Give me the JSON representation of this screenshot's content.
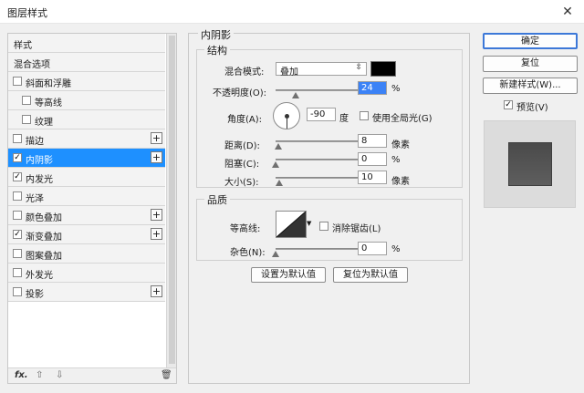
{
  "window": {
    "title": "图层样式",
    "close_glyph": "✕"
  },
  "left": {
    "items": [
      {
        "label": "样式",
        "has_check": false,
        "checked": false,
        "indent": 0,
        "has_plus": false,
        "selected": false
      },
      {
        "label": "混合选项",
        "has_check": false,
        "checked": false,
        "indent": 0,
        "has_plus": false,
        "selected": false
      },
      {
        "label": "斜面和浮雕",
        "has_check": true,
        "checked": false,
        "indent": 0,
        "has_plus": false,
        "selected": false
      },
      {
        "label": "等高线",
        "has_check": true,
        "checked": false,
        "indent": 1,
        "has_plus": false,
        "selected": false
      },
      {
        "label": "纹理",
        "has_check": true,
        "checked": false,
        "indent": 1,
        "has_plus": false,
        "selected": false
      },
      {
        "label": "描边",
        "has_check": true,
        "checked": false,
        "indent": 0,
        "has_plus": true,
        "selected": false
      },
      {
        "label": "内阴影",
        "has_check": true,
        "checked": true,
        "indent": 0,
        "has_plus": true,
        "selected": true
      },
      {
        "label": "内发光",
        "has_check": true,
        "checked": true,
        "indent": 0,
        "has_plus": false,
        "selected": false
      },
      {
        "label": "光泽",
        "has_check": true,
        "checked": false,
        "indent": 0,
        "has_plus": false,
        "selected": false
      },
      {
        "label": "颜色叠加",
        "has_check": true,
        "checked": false,
        "indent": 0,
        "has_plus": true,
        "selected": false
      },
      {
        "label": "渐变叠加",
        "has_check": true,
        "checked": true,
        "indent": 0,
        "has_plus": true,
        "selected": false
      },
      {
        "label": "图案叠加",
        "has_check": true,
        "checked": false,
        "indent": 0,
        "has_plus": false,
        "selected": false
      },
      {
        "label": "外发光",
        "has_check": true,
        "checked": false,
        "indent": 0,
        "has_plus": false,
        "selected": false
      },
      {
        "label": "投影",
        "has_check": true,
        "checked": false,
        "indent": 0,
        "has_plus": true,
        "selected": false
      }
    ],
    "footer": {
      "fx": "fx.",
      "up": "⇧",
      "down": "⇩",
      "trash": "🗑"
    }
  },
  "inner_shadow": {
    "section_title": "内阴影",
    "structure_title": "结构",
    "blend_mode_label": "混合模式:",
    "blend_mode_value": "叠加",
    "blend_color": "#000000",
    "opacity_label": "不透明度(O):",
    "opacity_value": "24",
    "opacity_unit": "%",
    "opacity_level": 24,
    "angle_label": "角度(A):",
    "angle_value": "-90",
    "angle_unit": "度",
    "global_light_label": "使用全局光(G)",
    "distance_label": "距离(D):",
    "distance_value": "8",
    "distance_unit": "像素",
    "distance_level": 3,
    "choke_label": "阻塞(C):",
    "choke_value": "0",
    "choke_unit": "%",
    "choke_level": 0,
    "size_label": "大小(S):",
    "size_value": "10",
    "size_unit": "像素",
    "size_level": 4,
    "quality_title": "品质",
    "contour_label": "等高线:",
    "antialias_label": "消除锯齿(L)",
    "noise_label": "杂色(N):",
    "noise_value": "0",
    "noise_unit": "%",
    "noise_level": 0,
    "set_default": "设置为默认值",
    "reset_default": "复位为默认值"
  },
  "right": {
    "ok": "确定",
    "reset": "复位",
    "new_style": "新建样式(W)...",
    "preview_label": "预览(V)",
    "preview_checked": true
  },
  "colors": {
    "selection": "#1e90ff"
  }
}
